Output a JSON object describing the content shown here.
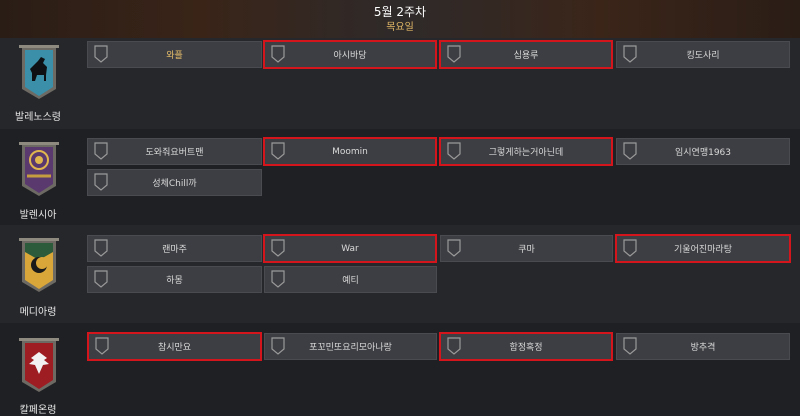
{
  "header": {
    "title": "5월 2주차",
    "day": "목요일"
  },
  "colors": {
    "highlight": "#d4151b",
    "gold": "#e8bf6a"
  },
  "regions": [
    {
      "name": "발레노스령",
      "crest_icon": "horse-crest-icon",
      "slots": [
        {
          "label": "와플",
          "highlighted": false
        },
        {
          "label": "아시바당",
          "highlighted": true
        },
        {
          "label": "십용루",
          "highlighted": true
        },
        {
          "label": "킹도사리",
          "highlighted": false
        }
      ]
    },
    {
      "name": "발렌시아",
      "crest_icon": "sun-eye-crest-icon",
      "slots": [
        {
          "label": "도와줘요버트맨",
          "highlighted": false
        },
        {
          "label": "Moomin",
          "highlighted": true
        },
        {
          "label": "그렇게하는거아닌데",
          "highlighted": true
        },
        {
          "label": "임시연맹1963",
          "highlighted": false
        },
        {
          "label": "성체Chill까",
          "highlighted": false
        }
      ]
    },
    {
      "name": "메디아령",
      "crest_icon": "moon-crest-icon",
      "slots": [
        {
          "label": "랜마주",
          "highlighted": false
        },
        {
          "label": "War",
          "highlighted": true
        },
        {
          "label": "쿠마",
          "highlighted": false
        },
        {
          "label": "기울어진마라탕",
          "highlighted": true
        },
        {
          "label": "하몽",
          "highlighted": false
        },
        {
          "label": "예티",
          "highlighted": false
        }
      ]
    },
    {
      "name": "칼페온령",
      "crest_icon": "phoenix-crest-icon",
      "slots": [
        {
          "label": "참시만요",
          "highlighted": true
        },
        {
          "label": "포꼬민또요리모아나랑",
          "highlighted": false
        },
        {
          "label": "함정혹정",
          "highlighted": true
        },
        {
          "label": "방추격",
          "highlighted": false
        }
      ]
    }
  ]
}
